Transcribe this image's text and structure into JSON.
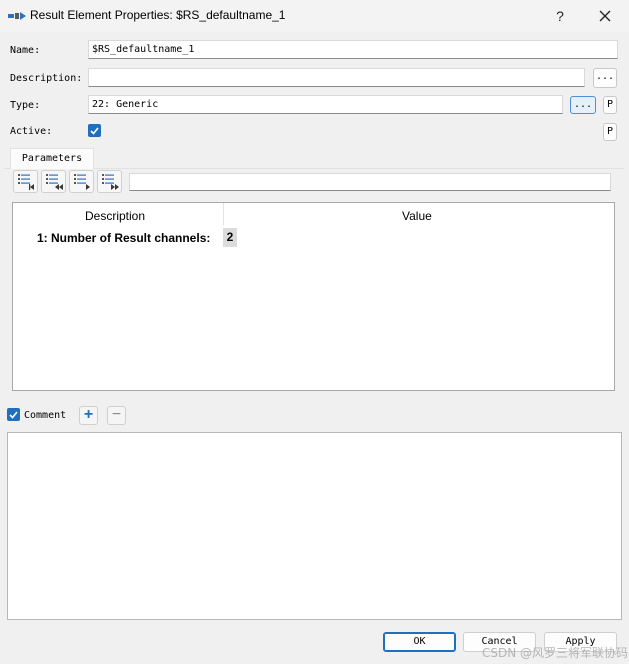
{
  "window": {
    "title": "Result Element Properties: $RS_defaultname_1",
    "help_label": "?",
    "close_label": "×"
  },
  "form": {
    "name_label": "Name:",
    "name_value": "$RS_defaultname_1",
    "description_label": "Description:",
    "description_value": "",
    "description_browse": "...",
    "type_label": "Type:",
    "type_value": "22: Generic",
    "type_browse": "...",
    "type_p": "P",
    "active_label": "Active:",
    "active_checked": true,
    "active_p": "P"
  },
  "tabs": [
    {
      "label": "Parameters",
      "selected": true
    }
  ],
  "toolbar": {
    "icons": [
      "list-first-icon",
      "list-prev-icon",
      "list-next-icon",
      "list-last-icon"
    ],
    "filter_value": ""
  },
  "grid": {
    "headers": [
      "Description",
      "Value"
    ],
    "rows": [
      {
        "description": "1: Number of Result channels:",
        "value": "2"
      }
    ]
  },
  "comment": {
    "label": "Comment",
    "checked": true,
    "add_label": "+",
    "remove_label": "−",
    "text": ""
  },
  "buttons": {
    "ok": "OK",
    "cancel": "Cancel",
    "apply": "Apply"
  },
  "watermark": "CSDN @风罗三将军联协码",
  "colors": {
    "accent": "#1f6fbf",
    "window_bg": "#f0f0f0"
  }
}
